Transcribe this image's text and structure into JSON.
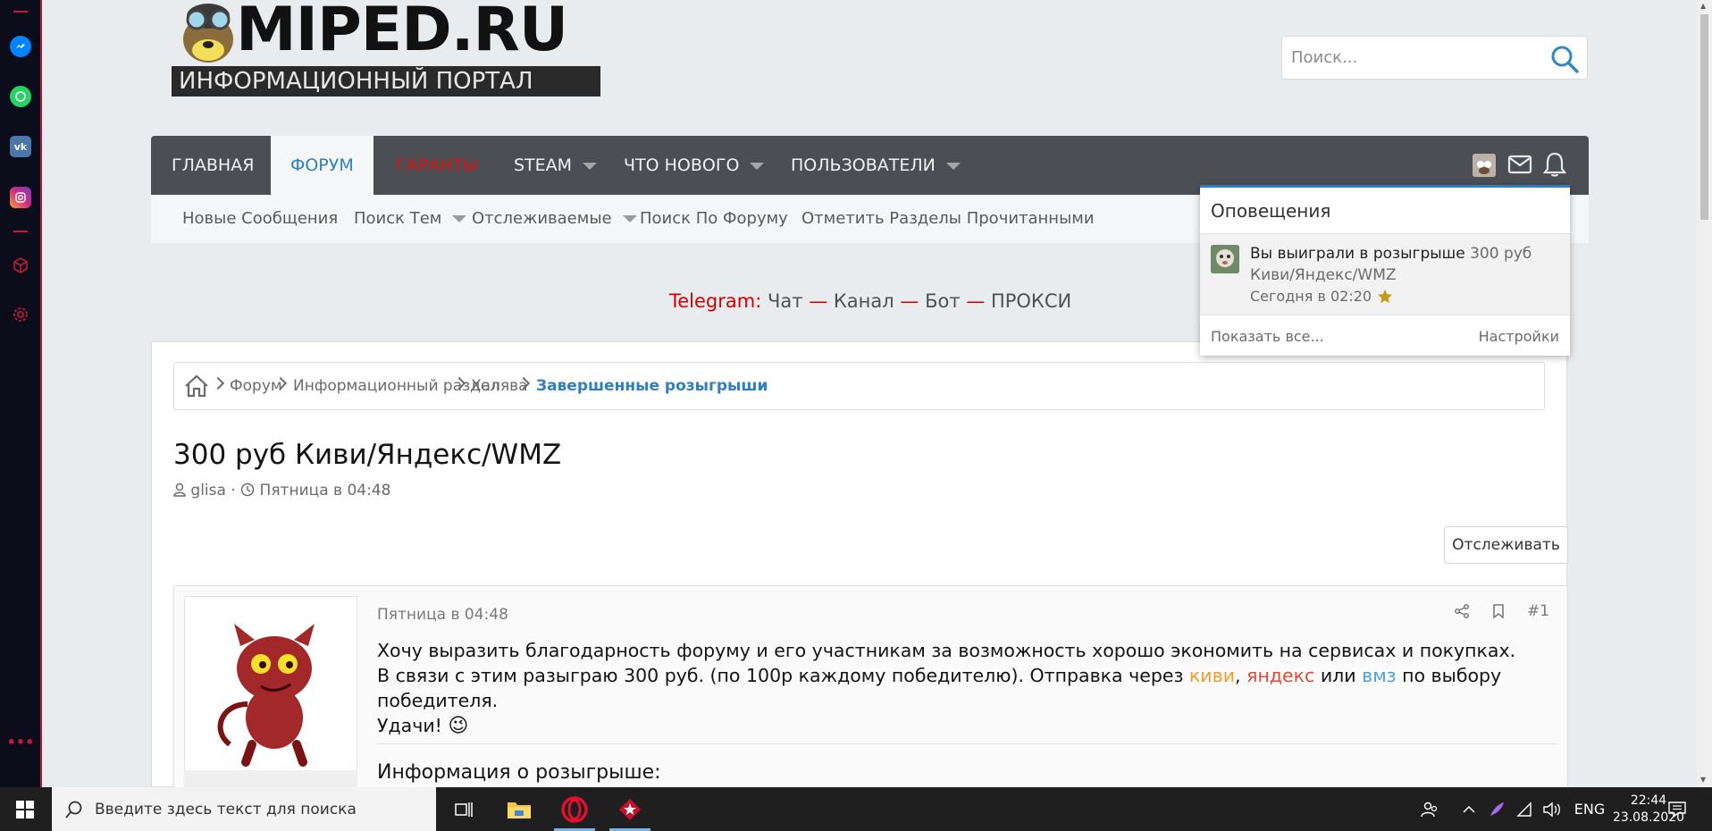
{
  "site": {
    "logo_text": "MIPED.RU",
    "logo_subtitle": "ИНФОРМАЦИОННЫЙ ПОРТАЛ"
  },
  "search": {
    "placeholder": "Поиск..."
  },
  "nav": {
    "tabs": [
      {
        "label": "ГЛАВНАЯ"
      },
      {
        "label": "ФОРУМ"
      },
      {
        "label": "ГАРАНТЫ"
      },
      {
        "label": "STEAM"
      },
      {
        "label": "ЧТО НОВОГО"
      },
      {
        "label": "ПОЛЬЗОВАТЕЛИ"
      }
    ]
  },
  "subnav": {
    "items": [
      {
        "label": "Новые Сообщения"
      },
      {
        "label": "Поиск Тем"
      },
      {
        "label": "Отслеживаемые"
      },
      {
        "label": "Поиск По Форуму"
      },
      {
        "label": "Отметить Разделы Прочитанными"
      }
    ]
  },
  "telegram": {
    "prefix": "Telegram:",
    "chat": "Чат",
    "dash": "—",
    "channel": "Канал",
    "bot": "Бот",
    "proxy": "ПРОКСИ"
  },
  "breadcrumb": {
    "items": [
      "Форум",
      "Информационный раздел",
      "Халява",
      "Завершенные розыгрыши"
    ]
  },
  "thread": {
    "title": "300 руб Киви/Яндекс/WMZ",
    "author": "glisa",
    "separator": "·",
    "date": "Пятница в 04:48",
    "follow_label": "Отслеживать"
  },
  "post": {
    "time": "Пятница в 04:48",
    "number": "#1",
    "line1": "Хочу выразить благодарность форуму и его участникам за возможность хорошо экономить на сервисах и покупках.",
    "line2_a": "В связи с этим разыграю 300 руб. (по 100р каждому победителю). Отправка через",
    "kiwi": "киви",
    "comma": ",",
    "yandex": "яндекс",
    "or": "или",
    "wmz": "вмз",
    "line2_b": "по выбору",
    "line3": "победителя.",
    "line4": "Удачи!",
    "emoji": "😉",
    "info_heading": "Информация о розыгрыше:"
  },
  "notifications": {
    "title": "Оповещения",
    "item_text": "Вы выиграли в розыгрыше",
    "item_subject": "300 руб Киви/Яндекс/WMZ",
    "item_time": "Сегодня в 02:20",
    "show_all": "Показать все...",
    "settings": "Настройки"
  },
  "taskbar": {
    "search_placeholder": "Введите здесь текст для поиска",
    "language": "ENG",
    "time": "22:44",
    "date": "23.08.2020"
  },
  "colors": {
    "nav_bg": "#4b4e53",
    "accent_blue": "#2f7fc1",
    "red": "#d40000"
  }
}
